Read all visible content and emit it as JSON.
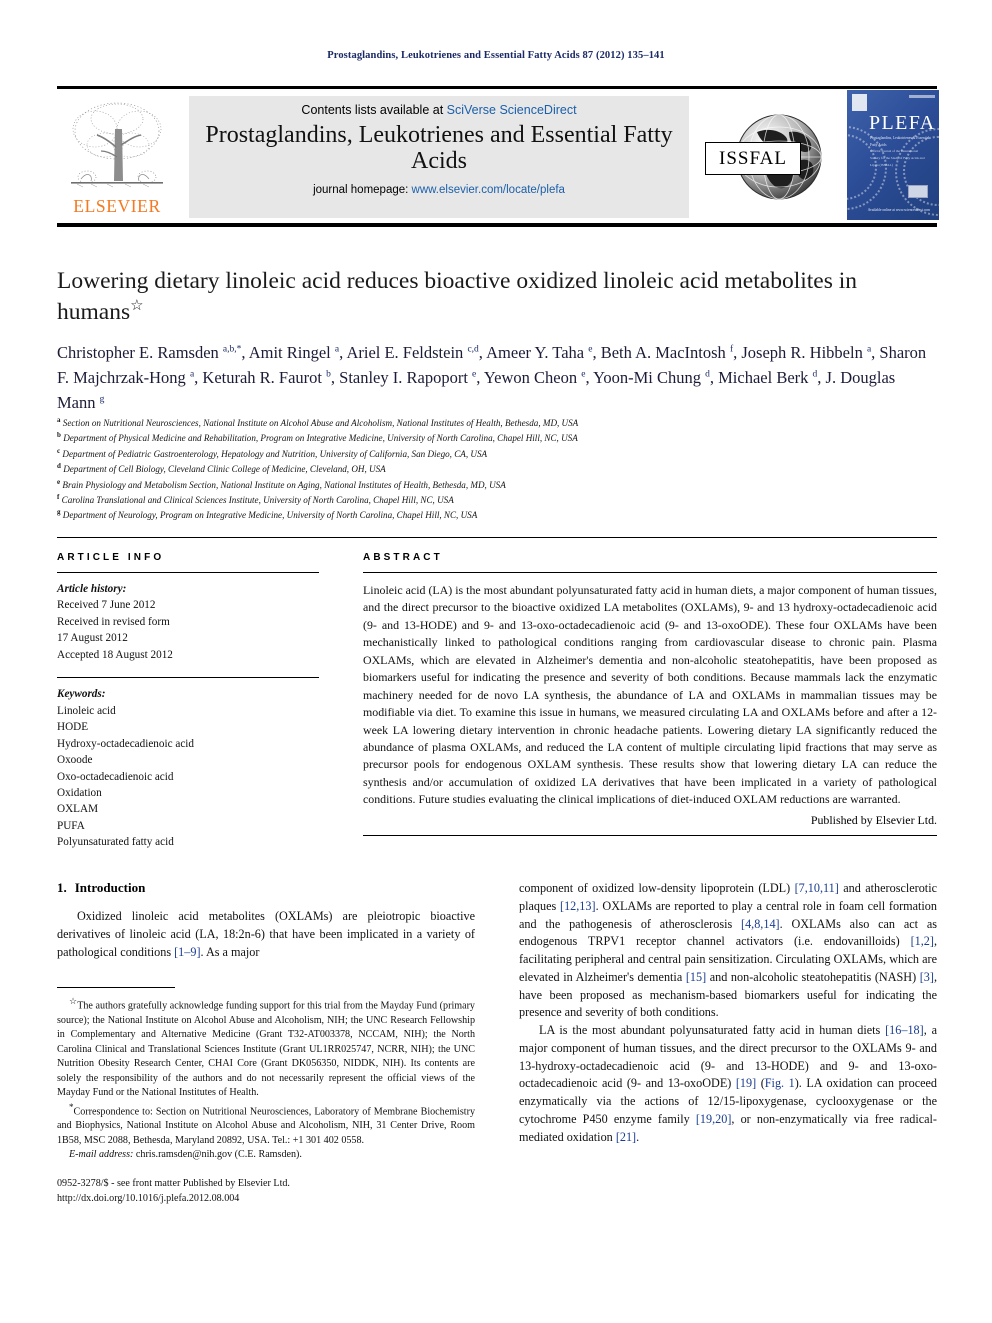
{
  "running_head": "Prostaglandins, Leukotrienes and Essential Fatty Acids 87 (2012) 135–141",
  "masthead": {
    "contents_prefix": "Contents lists available at ",
    "contents_link": "SciVerse ScienceDirect",
    "journal_title": "Prostaglandins, Leukotrienes and Essential Fatty Acids",
    "homepage_prefix": "journal homepage: ",
    "homepage_link": "www.elsevier.com/locate/plefa",
    "publisher_wordmark": "ELSEVIER",
    "society_logo_text": "ISSFAL",
    "cover_title": "PLEFA",
    "cover_subtitle": "Prostaglandins, Leukotrienes & Essential Fatty Acids",
    "cover_tagline": "Official Journal of the International Society for the Study of Fatty Acids and Lipids (ISSFAL)",
    "cover_footer": "Available online at www.sciencedirect.com",
    "link_color": "#1b5faa",
    "elsevier_orange": "#F47920"
  },
  "article": {
    "title": "Lowering dietary linoleic acid reduces bioactive oxidized linoleic acid metabolites in humans",
    "title_star": "☆",
    "authors_html": "Christopher E. Ramsden <sup>a,b,</sup><sup>*</sup>, Amit Ringel <sup>a</sup>, Ariel E. Feldstein <sup>c,d</sup>, Ameer Y. Taha <sup>e</sup>, Beth A. MacIntosh <sup>f</sup>, Joseph R. Hibbeln <sup>a</sup>, Sharon F. Majchrzak-Hong <sup>a</sup>, Keturah R. Faurot <sup>b</sup>, Stanley I. Rapoport <sup>e</sup>, Yewon Cheon <sup>e</sup>, Yoon-Mi Chung <sup>d</sup>, Michael Berk <sup>d</sup>, J. Douglas Mann <sup>g</sup>",
    "affiliations": [
      {
        "mark": "a",
        "text": "Section on Nutritional Neurosciences, National Institute on Alcohol Abuse and Alcoholism, National Institutes of Health, Bethesda, MD, USA"
      },
      {
        "mark": "b",
        "text": "Department of Physical Medicine and Rehabilitation, Program on Integrative Medicine, University of North Carolina, Chapel Hill, NC, USA"
      },
      {
        "mark": "c",
        "text": "Department of Pediatric Gastroenterology, Hepatology and Nutrition, University of California, San Diego, CA, USA"
      },
      {
        "mark": "d",
        "text": "Department of Cell Biology, Cleveland Clinic College of Medicine, Cleveland, OH, USA"
      },
      {
        "mark": "e",
        "text": "Brain Physiology and Metabolism Section, National Institute on Aging, National Institutes of Health, Bethesda, MD, USA"
      },
      {
        "mark": "f",
        "text": "Carolina Translational and Clinical Sciences Institute, University of North Carolina, Chapel Hill, NC, USA"
      },
      {
        "mark": "g",
        "text": "Department of Neurology, Program on Integrative Medicine, University of North Carolina, Chapel Hill, NC, USA"
      }
    ]
  },
  "article_info": {
    "label": "ARTICLE INFO",
    "history_label": "Article history:",
    "history": [
      "Received 7 June 2012",
      "Received in revised form",
      "17 August 2012",
      "Accepted 18 August 2012"
    ],
    "keywords_label": "Keywords:",
    "keywords": [
      "Linoleic acid",
      "HODE",
      "Hydroxy-octadecadienoic acid",
      "Oxoode",
      "Oxo-octadecadienoic acid",
      "Oxidation",
      "OXLAM",
      "PUFA",
      "Polyunsaturated fatty acid"
    ]
  },
  "abstract": {
    "label": "ABSTRACT",
    "text": "Linoleic acid (LA) is the most abundant polyunsaturated fatty acid in human diets, a major component of human tissues, and the direct precursor to the bioactive oxidized LA metabolites (OXLAMs), 9- and 13 hydroxy-octadecadienoic acid (9- and 13-HODE) and 9- and 13-oxo-octadecadienoic acid (9- and 13-oxoODE). These four OXLAMs have been mechanistically linked to pathological conditions ranging from cardiovascular disease to chronic pain. Plasma OXLAMs, which are elevated in Alzheimer's dementia and non-alcoholic steatohepatitis, have been proposed as biomarkers useful for indicating the presence and severity of both conditions. Because mammals lack the enzymatic machinery needed for de novo LA synthesis, the abundance of LA and OXLAMs in mammalian tissues may be modifiable via diet. To examine this issue in humans, we measured circulating LA and OXLAMs before and after a 12-week LA lowering dietary intervention in chronic headache patients. Lowering dietary LA significantly reduced the abundance of plasma OXLAMs, and reduced the LA content of multiple circulating lipid fractions that may serve as precursor pools for endogenous OXLAM synthesis. These results show that lowering dietary LA can reduce the synthesis and/or accumulation of oxidized LA derivatives that have been implicated in a variety of pathological conditions. Future studies evaluating the clinical implications of diet-induced OXLAM reductions are warranted.",
    "published_by": "Published by Elsevier Ltd."
  },
  "introduction": {
    "number": "1.",
    "heading": "Introduction",
    "left_paragraph_html": "Oxidized linoleic acid metabolites (OXLAMs) are pleiotropic bioactive derivatives of linoleic acid (LA, 18:2n-6) that have been implicated in a variety of pathological conditions <span class=\"ref\">[1–9]</span>. As a major",
    "right_paragraph_1_html": "component of oxidized low-density lipoprotein (LDL) <span class=\"ref\">[7,10,11]</span> and atherosclerotic plaques <span class=\"ref\">[12,13]</span>. OXLAMs are reported to play a central role in foam cell formation and the pathogenesis of atherosclerosis <span class=\"ref\">[4,8,14]</span>. OXLAMs also can act as endogenous TRPV1 receptor channel activators (i.e. endovanilloids) <span class=\"ref\">[1,2]</span>, facilitating peripheral and central pain sensitization. Circulating OXLAMs, which are elevated in Alzheimer's dementia <span class=\"ref\">[15]</span> and non-alcoholic steatohepatitis (NASH) <span class=\"ref\">[3]</span>, have been proposed as mechanism-based biomarkers useful for indicating the presence and severity of both conditions.",
    "right_paragraph_2_html": "LA is the most abundant polyunsaturated fatty acid in human diets <span class=\"ref\">[16–18]</span>, a major component of human tissues, and the direct precursor to the OXLAMs 9- and 13-hydroxy-octadecadienoic acid (9- and 13-HODE) and 9- and 13-oxo-octadecadienoic acid (9- and 13-oxoODE) <span class=\"ref\">[19]</span> (<span class=\"ref\">Fig. 1</span>). LA oxidation can proceed enzymatically via the actions of 12/15-lipoxygenase, cyclooxygenase or the cytochrome P450 enzyme family <span class=\"ref\">[19,20]</span>, or non-enzymatically via free radical-mediated oxidation <span class=\"ref\">[21]</span>."
  },
  "footnotes": {
    "funding_mark": "☆",
    "funding_text": "The authors gratefully acknowledge funding support for this trial from the Mayday Fund (primary source); the National Institute on Alcohol Abuse and Alcoholism, NIH; the UNC Research Fellowship in Complementary and Alternative Medicine (Grant T32-AT003378, NCCAM, NIH); the North Carolina Clinical and Translational Sciences Institute (Grant UL1RR025747, NCRR, NIH); the UNC Nutrition Obesity Research Center, CHAI Core (Grant DK056350, NIDDK, NIH). Its contents are solely the responsibility of the authors and do not necessarily represent the official views of the Mayday Fund or the National Institutes of Health.",
    "correspondence_mark": "*",
    "correspondence_text": "Correspondence to: Section on Nutritional Neurosciences, Laboratory of Membrane Biochemistry and Biophysics, National Institute on Alcohol Abuse and Alcoholism, NIH, 31 Center Drive, Room 1B58, MSC 2088, Bethesda, Maryland 20892, USA. Tel.: +1 301 402 0558.",
    "email_label": "E-mail address:",
    "email_value": "chris.ramsden@nih.gov (C.E. Ramsden).",
    "issn_line": "0952-3278/$ - see front matter Published by Elsevier Ltd.",
    "doi_line": "http://dx.doi.org/10.1016/j.plefa.2012.08.004"
  }
}
